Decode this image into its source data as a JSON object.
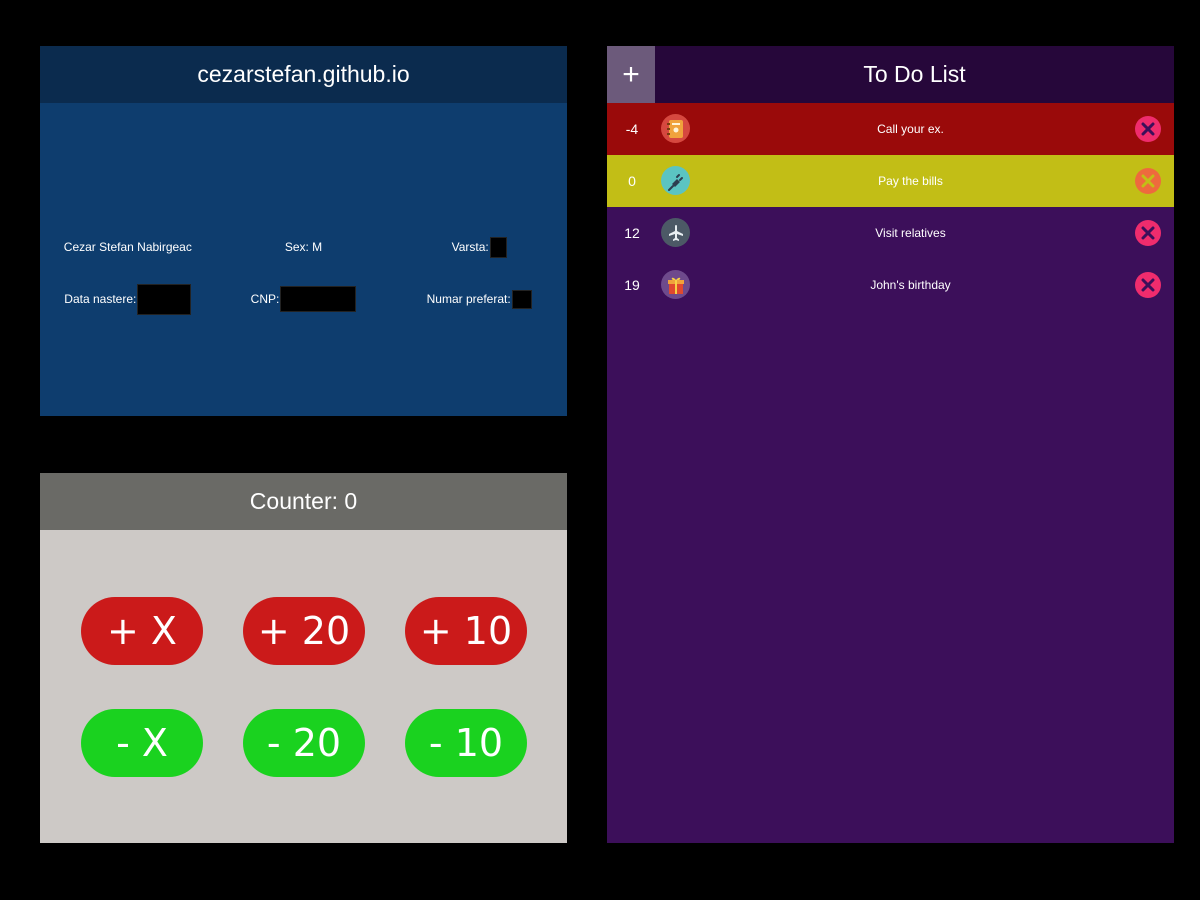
{
  "profile": {
    "title": "cezarstefan.github.io",
    "name": "Cezar Stefan Nabirgeac",
    "sex_label": "Sex: M",
    "age_label": "Varsta:",
    "birth_label": "Data nastere:",
    "cnp_label": "CNP:",
    "fav_number_label": "Numar preferat:"
  },
  "counter": {
    "title": "Counter: 0",
    "buttons": [
      {
        "label": "+ X",
        "kind": "increment"
      },
      {
        "label": "+ 20",
        "kind": "increment"
      },
      {
        "label": "+ 10",
        "kind": "increment"
      },
      {
        "label": "- X",
        "kind": "decrement"
      },
      {
        "label": "- 20",
        "kind": "decrement"
      },
      {
        "label": "- 10",
        "kind": "decrement"
      }
    ],
    "colors": {
      "increment": "#cb1a1a",
      "decrement": "#1ad21f"
    }
  },
  "todo": {
    "title": "To Do List",
    "add_label": "+",
    "items": [
      {
        "num": "-4",
        "text": "Call your ex.",
        "icon": "address-book-icon",
        "row_color": "#9a0a0a"
      },
      {
        "num": "0",
        "text": "Pay the bills",
        "icon": "plug-icon",
        "row_color": "#c2be16"
      },
      {
        "num": "12",
        "text": "Visit relatives",
        "icon": "airplane-icon",
        "row_color": "#3c0f5a"
      },
      {
        "num": "19",
        "text": "John's birthday",
        "icon": "gift-icon",
        "row_color": "#3c0f5a"
      }
    ]
  }
}
